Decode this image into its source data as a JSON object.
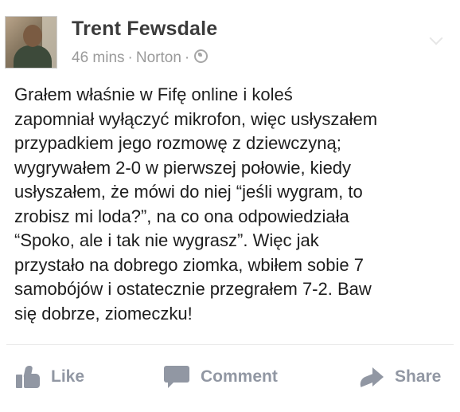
{
  "post": {
    "author": "Trent Fewsdale",
    "time": "46 mins",
    "location": "Norton",
    "separator_1": "·",
    "separator_2": "·",
    "privacy_icon": "globe-icon",
    "body": "Grałem właśnie w Fifę online i koleś\nzapomniał wyłączyć mikrofon, więc usłyszałem\nprzypadkiem jego rozmowę z dziewczyną;\nwygrywałem 2-0 w pierwszej połowie, kiedy\nusłyszałem, że mówi do niej “jeśli wygram, to\nzrobisz mi loda?”, na co ona odpowiedziała\n“Spoko, ale i tak nie wygrasz”. Więc jak\nprzystało na dobrego ziomka, wbiłem sobie 7\nsamobójów i ostatecznie przegrałem 7-2. Baw\nsię dobrze, ziomeczku!"
  },
  "actions": {
    "like": {
      "label": "Like",
      "icon": "thumbs-up-icon"
    },
    "comment": {
      "label": "Comment",
      "icon": "speech-bubble-icon"
    },
    "share": {
      "label": "Share",
      "icon": "share-arrow-icon"
    }
  },
  "colors": {
    "action_text": "#9197a3",
    "author_text": "#3b3b3b",
    "meta_text": "#9a9a9a",
    "body_text": "#1d1d1d"
  }
}
